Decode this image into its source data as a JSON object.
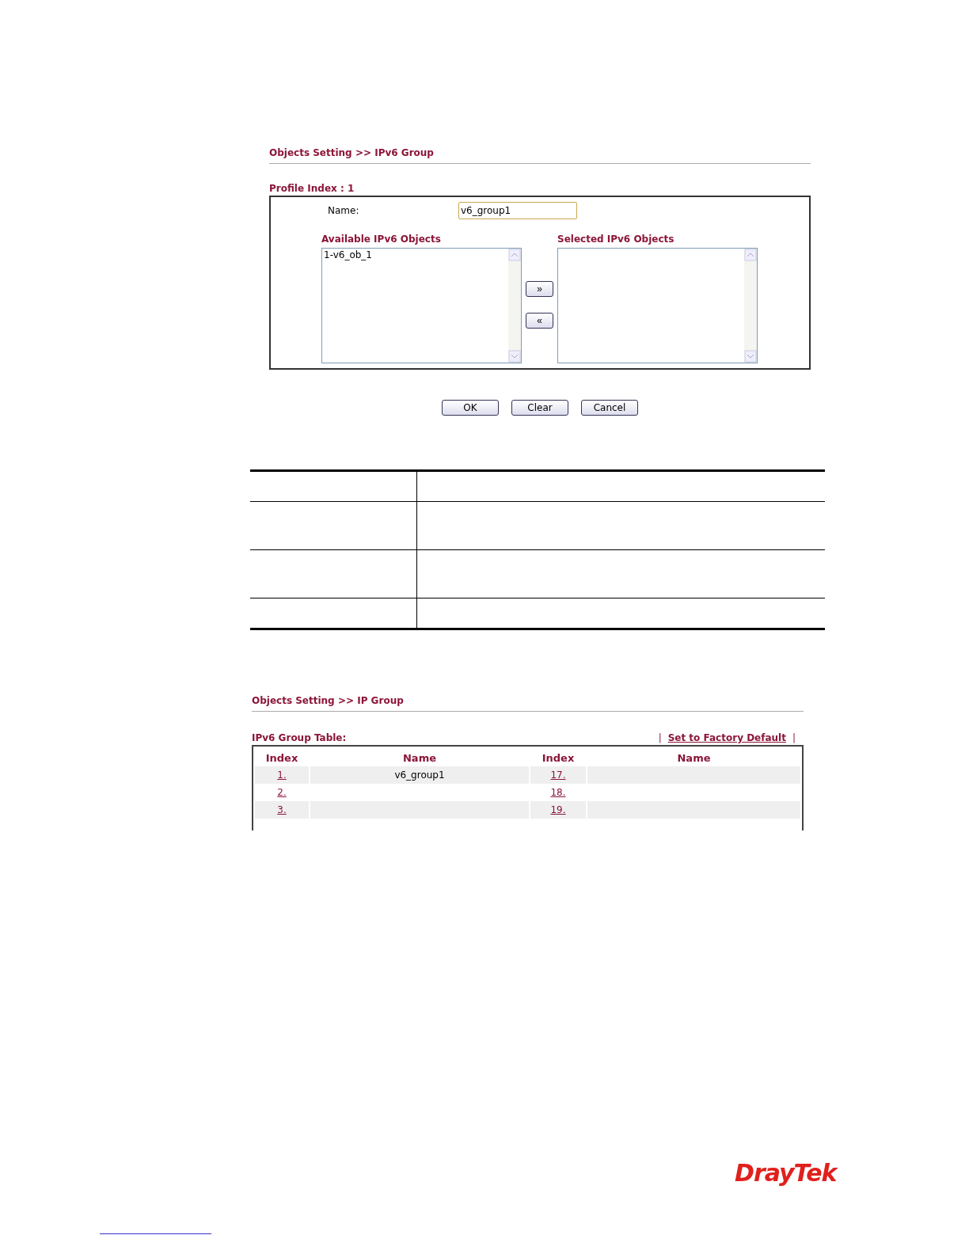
{
  "group_form": {
    "breadcrumb": "Objects Setting >> IPv6 Group",
    "profile_label": "Profile Index : 1",
    "name_label": "Name:",
    "name_value": "v6_group1",
    "available": {
      "title": "Available IPv6 Objects",
      "items": [
        "1-v6_ob_1"
      ]
    },
    "selected": {
      "title": "Selected IPv6 Objects"
    },
    "move_buttons": [
      "»",
      "«"
    ],
    "buttons": [
      "OK",
      "Clear",
      "Cancel"
    ]
  },
  "group_table": {
    "breadcrumb": "Objects Setting >> IP Group",
    "title": "IPv6 Group Table:",
    "factory_link": "Set to Factory Default",
    "separator": "|",
    "columns": [
      "Index",
      "Name",
      "Index",
      "Name"
    ],
    "rows": [
      {
        "index_1": "1.",
        "name_1": "v6_group1",
        "index_2": "17."
      },
      {
        "index_1": "2.",
        "index_2": "18."
      },
      {
        "index_1": "3.",
        "index_2": "19."
      }
    ]
  },
  "logo": "DrayTek"
}
